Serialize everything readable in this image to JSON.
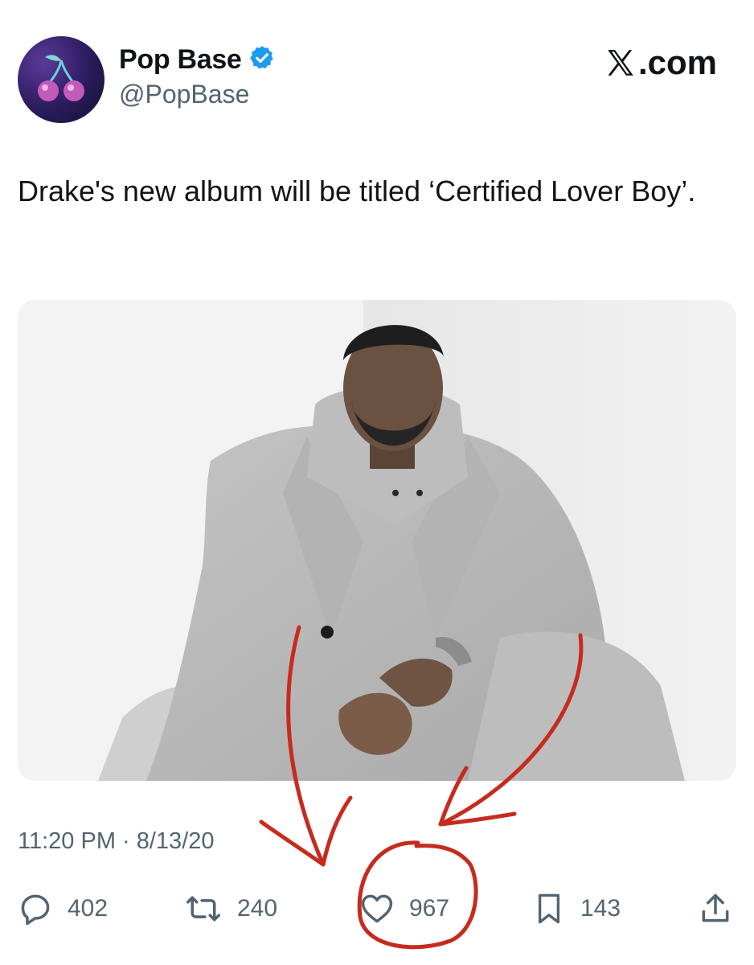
{
  "header": {
    "display_name": "Pop Base",
    "handle": "@PopBase",
    "verified": true,
    "brand": ".com",
    "avatar_icon": "cherry-icon"
  },
  "tweet": {
    "text": "Drake's new album will be titled ‘Certified Lover Boy’.",
    "timestamp": "11:20 PM · 8/13/20"
  },
  "actions": {
    "replies": "402",
    "reposts": "240",
    "likes": "967",
    "bookmarks": "143"
  },
  "colors": {
    "verified_badge": "#1d9bf0",
    "secondary_text": "#536471",
    "annotation_red": "#c62b1e"
  }
}
